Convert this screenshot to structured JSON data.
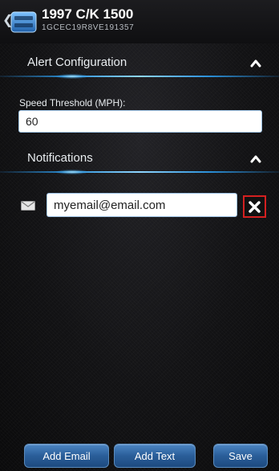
{
  "header": {
    "back_icon": "chevron-left-icon",
    "vehicle_name": "1997 C/K 1500",
    "vin": "1GCEC19R8VE191357"
  },
  "alert_configuration": {
    "title": "Alert Configuration",
    "collapse_icon": "chevron-up-icon",
    "speed_label": "Speed Threshold (MPH):",
    "speed_value": "60"
  },
  "notifications": {
    "title": "Notifications",
    "collapse_icon": "chevron-up-icon",
    "email_icon": "envelope-icon",
    "email_value": "myemail@email.com",
    "remove_icon": "close-icon"
  },
  "footer": {
    "add_email_label": "Add Email",
    "add_text_label": "Add Text",
    "save_label": "Save"
  },
  "colors": {
    "accent_blue": "#2a8fd8",
    "button_blue": "#2a5e99",
    "remove_highlight": "#d42020",
    "background": "#121214"
  }
}
